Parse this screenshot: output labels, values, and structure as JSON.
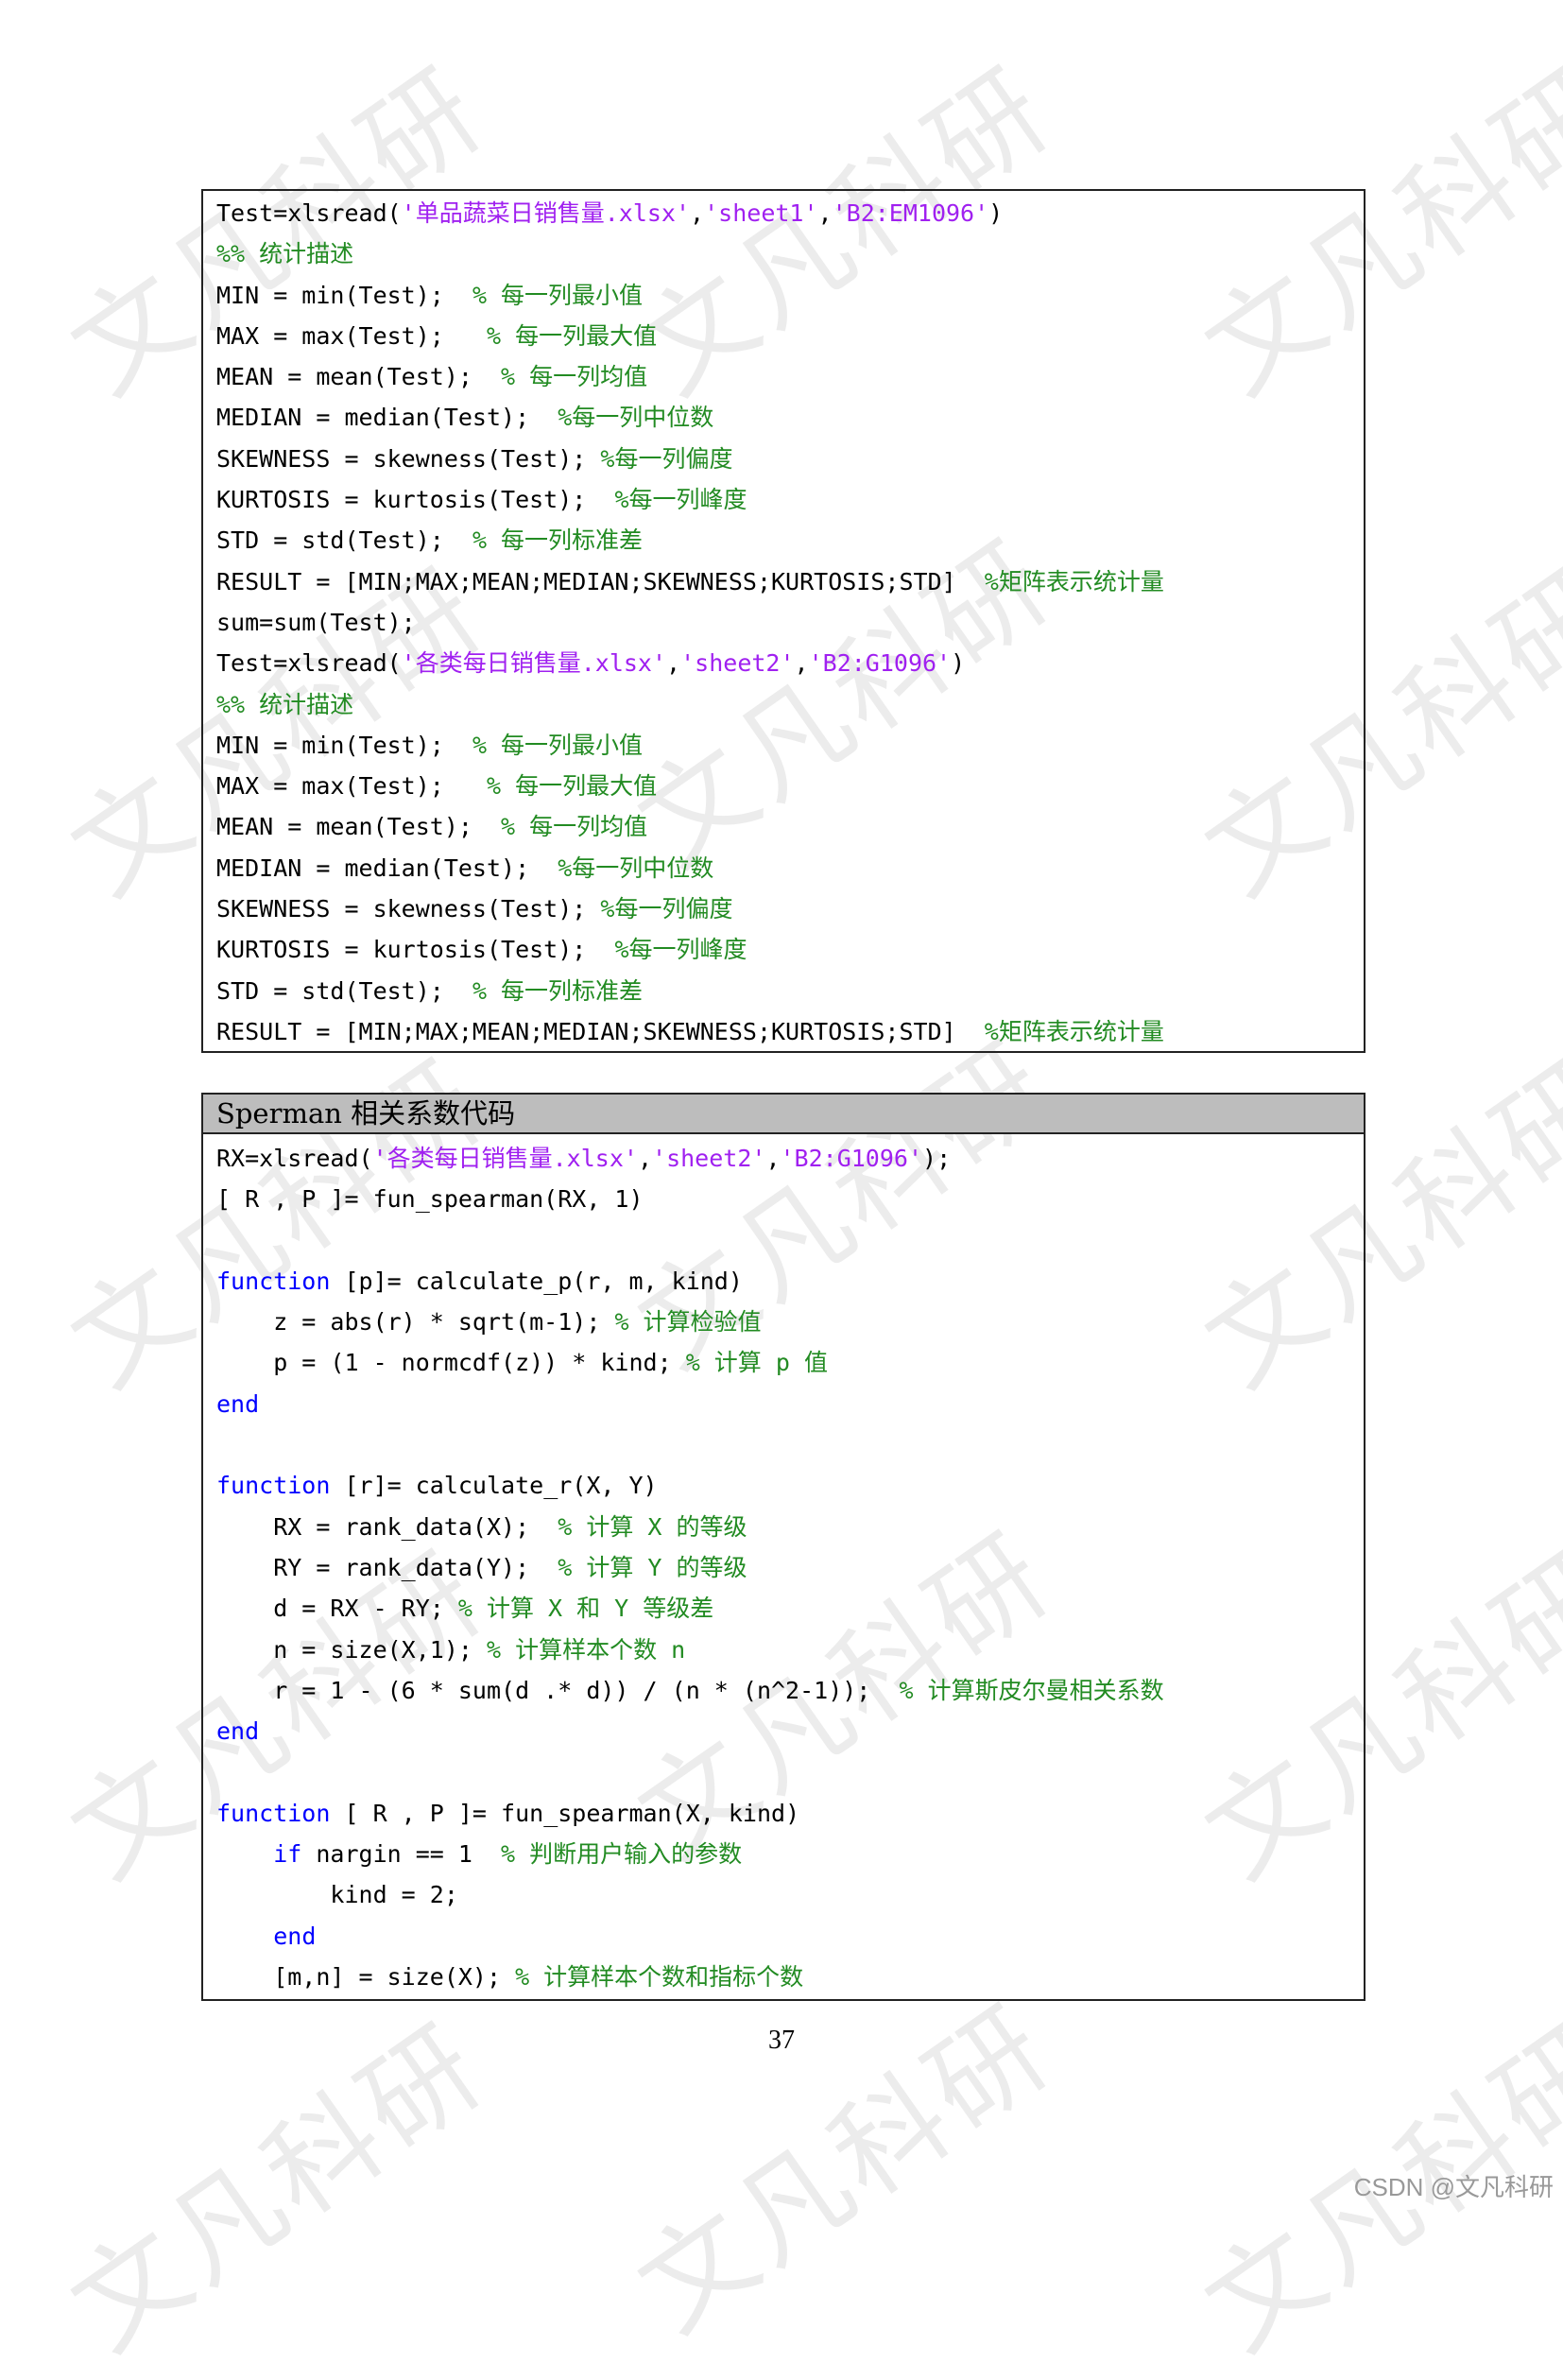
{
  "watermark": "文凡科研",
  "block1": {
    "lines": [
      [
        {
          "t": "Test=xlsread("
        },
        {
          "t": "'单品蔬菜日销售量.xlsx'",
          "c": "str"
        },
        {
          "t": ","
        },
        {
          "t": "'sheet1'",
          "c": "str"
        },
        {
          "t": ","
        },
        {
          "t": "'B2:EM1096'",
          "c": "str"
        },
        {
          "t": ")"
        }
      ],
      [
        {
          "t": "%% 统计描述",
          "c": "cmt"
        }
      ],
      [
        {
          "t": "MIN = min(Test);  "
        },
        {
          "t": "% 每一列最小值",
          "c": "cmt"
        }
      ],
      [
        {
          "t": "MAX = max(Test);   "
        },
        {
          "t": "% 每一列最大值",
          "c": "cmt"
        }
      ],
      [
        {
          "t": "MEAN = mean(Test);  "
        },
        {
          "t": "% 每一列均值",
          "c": "cmt"
        }
      ],
      [
        {
          "t": "MEDIAN = median(Test);  "
        },
        {
          "t": "%每一列中位数",
          "c": "cmt"
        }
      ],
      [
        {
          "t": "SKEWNESS = skewness(Test); "
        },
        {
          "t": "%每一列偏度",
          "c": "cmt"
        }
      ],
      [
        {
          "t": "KURTOSIS = kurtosis(Test);  "
        },
        {
          "t": "%每一列峰度",
          "c": "cmt"
        }
      ],
      [
        {
          "t": "STD = std(Test);  "
        },
        {
          "t": "% 每一列标准差",
          "c": "cmt"
        }
      ],
      [
        {
          "t": "RESULT = [MIN;MAX;MEAN;MEDIAN;SKEWNESS;KURTOSIS;STD]  "
        },
        {
          "t": "%矩阵表示统计量",
          "c": "cmt"
        }
      ],
      [
        {
          "t": "sum=sum(Test);"
        }
      ],
      [
        {
          "t": "Test=xlsread("
        },
        {
          "t": "'各类每日销售量.xlsx'",
          "c": "str"
        },
        {
          "t": ","
        },
        {
          "t": "'sheet2'",
          "c": "str"
        },
        {
          "t": ","
        },
        {
          "t": "'B2:G1096'",
          "c": "str"
        },
        {
          "t": ")"
        }
      ],
      [
        {
          "t": "%% 统计描述",
          "c": "cmt"
        }
      ],
      [
        {
          "t": "MIN = min(Test);  "
        },
        {
          "t": "% 每一列最小值",
          "c": "cmt"
        }
      ],
      [
        {
          "t": "MAX = max(Test);   "
        },
        {
          "t": "% 每一列最大值",
          "c": "cmt"
        }
      ],
      [
        {
          "t": "MEAN = mean(Test);  "
        },
        {
          "t": "% 每一列均值",
          "c": "cmt"
        }
      ],
      [
        {
          "t": "MEDIAN = median(Test);  "
        },
        {
          "t": "%每一列中位数",
          "c": "cmt"
        }
      ],
      [
        {
          "t": "SKEWNESS = skewness(Test); "
        },
        {
          "t": "%每一列偏度",
          "c": "cmt"
        }
      ],
      [
        {
          "t": "KURTOSIS = kurtosis(Test);  "
        },
        {
          "t": "%每一列峰度",
          "c": "cmt"
        }
      ],
      [
        {
          "t": "STD = std(Test);  "
        },
        {
          "t": "% 每一列标准差",
          "c": "cmt"
        }
      ],
      [
        {
          "t": "RESULT = [MIN;MAX;MEAN;MEDIAN;SKEWNESS;KURTOSIS;STD]  "
        },
        {
          "t": "%矩阵表示统计量",
          "c": "cmt"
        }
      ]
    ]
  },
  "block2": {
    "header": "Sperman 相关系数代码",
    "lines": [
      [
        {
          "t": "RX=xlsread("
        },
        {
          "t": "'各类每日销售量.xlsx'",
          "c": "str"
        },
        {
          "t": ","
        },
        {
          "t": "'sheet2'",
          "c": "str"
        },
        {
          "t": ","
        },
        {
          "t": "'B2:G1096'",
          "c": "str"
        },
        {
          "t": ");"
        }
      ],
      [
        {
          "t": "[ R , P ]= fun_spearman(RX, 1)"
        }
      ],
      [],
      [
        {
          "t": "function",
          "c": "kw"
        },
        {
          "t": " [p]= calculate_p(r, m, kind)"
        }
      ],
      [
        {
          "t": "    z = abs(r) * sqrt(m-1); "
        },
        {
          "t": "% 计算检验值",
          "c": "cmt"
        }
      ],
      [
        {
          "t": "    p = (1 - normcdf(z)) * kind; "
        },
        {
          "t": "% 计算 p 值",
          "c": "cmt"
        }
      ],
      [
        {
          "t": "end",
          "c": "kw"
        }
      ],
      [],
      [
        {
          "t": "function",
          "c": "kw"
        },
        {
          "t": " [r]= calculate_r(X, Y)"
        }
      ],
      [
        {
          "t": "    RX = rank_data(X);  "
        },
        {
          "t": "% 计算 X 的等级",
          "c": "cmt"
        }
      ],
      [
        {
          "t": "    RY = rank_data(Y);  "
        },
        {
          "t": "% 计算 Y 的等级",
          "c": "cmt"
        }
      ],
      [
        {
          "t": "    d = RX - RY; "
        },
        {
          "t": "% 计算 X 和 Y 等级差",
          "c": "cmt"
        }
      ],
      [
        {
          "t": "    n = size(X,1); "
        },
        {
          "t": "% 计算样本个数 n",
          "c": "cmt"
        }
      ],
      [
        {
          "t": "    r = 1 - (6 * sum(d .* d)) / (n * (n^2-1));  "
        },
        {
          "t": "% 计算斯皮尔曼相关系数",
          "c": "cmt"
        }
      ],
      [
        {
          "t": "end",
          "c": "kw"
        }
      ],
      [],
      [
        {
          "t": "function",
          "c": "kw"
        },
        {
          "t": " [ R , P ]= fun_spearman(X, kind)"
        }
      ],
      [
        {
          "t": "    "
        },
        {
          "t": "if",
          "c": "kw"
        },
        {
          "t": " nargin == 1  "
        },
        {
          "t": "% 判断用户输入的参数",
          "c": "cmt"
        }
      ],
      [
        {
          "t": "        kind = 2;"
        }
      ],
      [
        {
          "t": "    "
        },
        {
          "t": "end",
          "c": "kw"
        }
      ],
      [
        {
          "t": "    [m,n] = size(X); "
        },
        {
          "t": "% 计算样本个数和指标个数",
          "c": "cmt"
        }
      ]
    ]
  },
  "page_number": "37",
  "credit": "CSDN @文凡科研"
}
